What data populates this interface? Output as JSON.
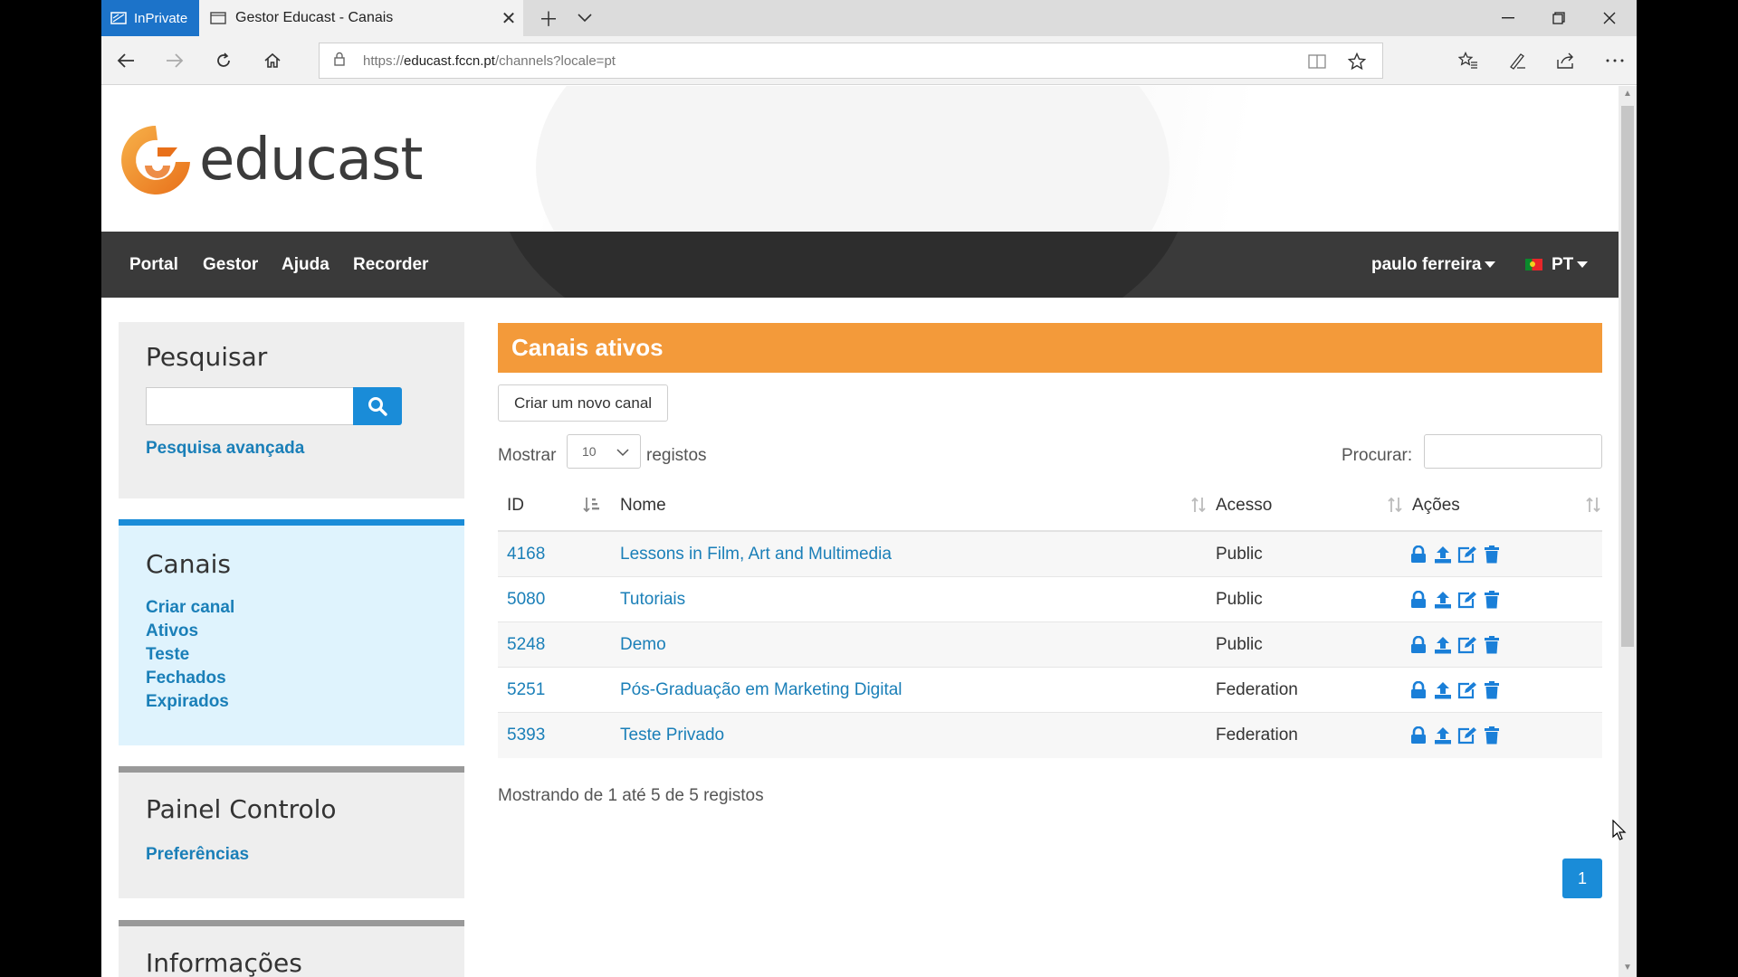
{
  "browser": {
    "inprivate_label": "InPrivate",
    "tab_title": "Gestor Educast - Canais",
    "url_prefix": "https://",
    "url_host": "educast.fccn.pt",
    "url_path": "/channels?locale=pt"
  },
  "site": {
    "logo_text": "educast",
    "nav": {
      "portal": "Portal",
      "gestor": "Gestor",
      "ajuda": "Ajuda",
      "recorder": "Recorder"
    },
    "user": "paulo ferreira",
    "language": "PT"
  },
  "sidebar": {
    "search": {
      "title": "Pesquisar",
      "advanced": "Pesquisa avançada"
    },
    "channels": {
      "title": "Canais",
      "links": [
        "Criar canal",
        "Ativos",
        "Teste",
        "Fechados",
        "Expirados"
      ]
    },
    "control": {
      "title": "Painel Controlo",
      "link": "Preferências"
    },
    "info": {
      "title": "Informações"
    }
  },
  "main": {
    "panel_title": "Canais ativos",
    "new_channel_button": "Criar um novo canal",
    "show_label": "Mostrar",
    "page_size": "10",
    "records_label": "registos",
    "find_label": "Procurar:",
    "columns": {
      "id": "ID",
      "name": "Nome",
      "access": "Acesso",
      "actions": "Ações"
    },
    "rows": [
      {
        "id": "4168",
        "name": "Lessons in Film, Art and Multimedia",
        "access": "Public"
      },
      {
        "id": "5080",
        "name": "Tutoriais",
        "access": "Public"
      },
      {
        "id": "5248",
        "name": "Demo",
        "access": "Public"
      },
      {
        "id": "5251",
        "name": "Pós-Graduação em Marketing Digital",
        "access": "Federation"
      },
      {
        "id": "5393",
        "name": "Teste Privado",
        "access": "Federation"
      }
    ],
    "summary": "Mostrando de 1 até 5 de 5 registos",
    "current_page": "1"
  },
  "colors": {
    "accent_orange": "#f39a3a",
    "link_blue": "#1a7fb8",
    "button_blue": "#1a8cd8",
    "nav_dark": "#3a3a3a",
    "inprivate_blue": "#1c73c9"
  }
}
